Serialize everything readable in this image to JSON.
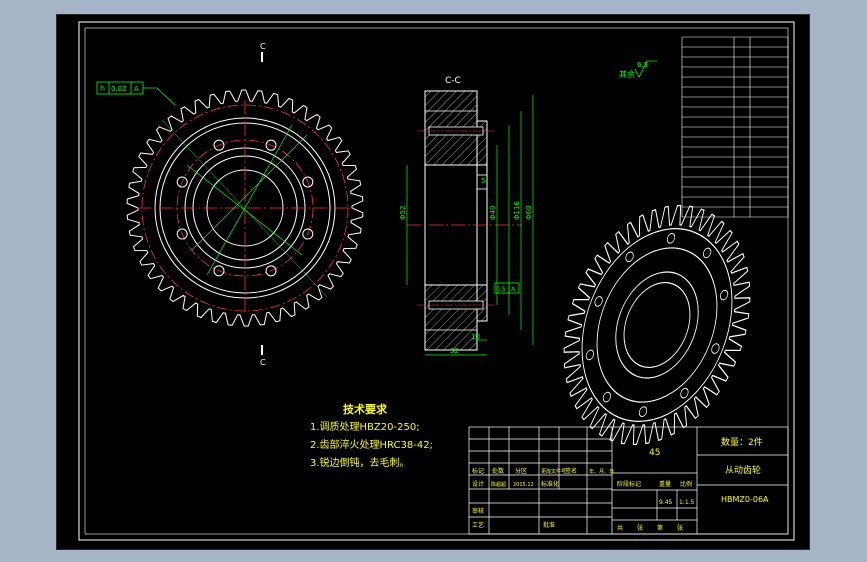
{
  "drawing": {
    "section_label": "C-C",
    "cut_mark": "C",
    "roughness_note": "其余",
    "roughness_value": "6.3",
    "tolerance_symbol": "h",
    "tolerance_value": "0.02",
    "datum": "A",
    "runout_value": "0.5",
    "dimensions": {
      "face_width": "32",
      "hub_length": "10",
      "keyway": "5",
      "bore": "Φ52",
      "outer": "Φ116",
      "pitch": "Φ40",
      "shaft_dia": "Φ60"
    }
  },
  "notes": {
    "title": "技术要求",
    "items": [
      "1.调质处理HBZ20-250;",
      "2.齿部淬火处理HRC38-42;",
      "3.锐边倒钝，去毛刺。"
    ]
  },
  "title_block": {
    "material": "45",
    "quantity": "数量：2件",
    "part_name": "从动齿轮",
    "drawing_no": "HBMZ0-06A",
    "ratio": "1:1.5",
    "weight": "9.45",
    "headers": [
      "标记",
      "处数",
      "分区",
      "更改文件号",
      "签名",
      "年、月、日"
    ],
    "row2": [
      "设计",
      "陈超超",
      "2015.12",
      "标准化"
    ],
    "row3": [
      "审核"
    ],
    "row4": [
      "工艺",
      "批准"
    ],
    "stage_headers": [
      "阶段标记",
      "重量",
      "比例"
    ],
    "sheet": [
      "共",
      "张",
      "第",
      "张"
    ]
  }
}
